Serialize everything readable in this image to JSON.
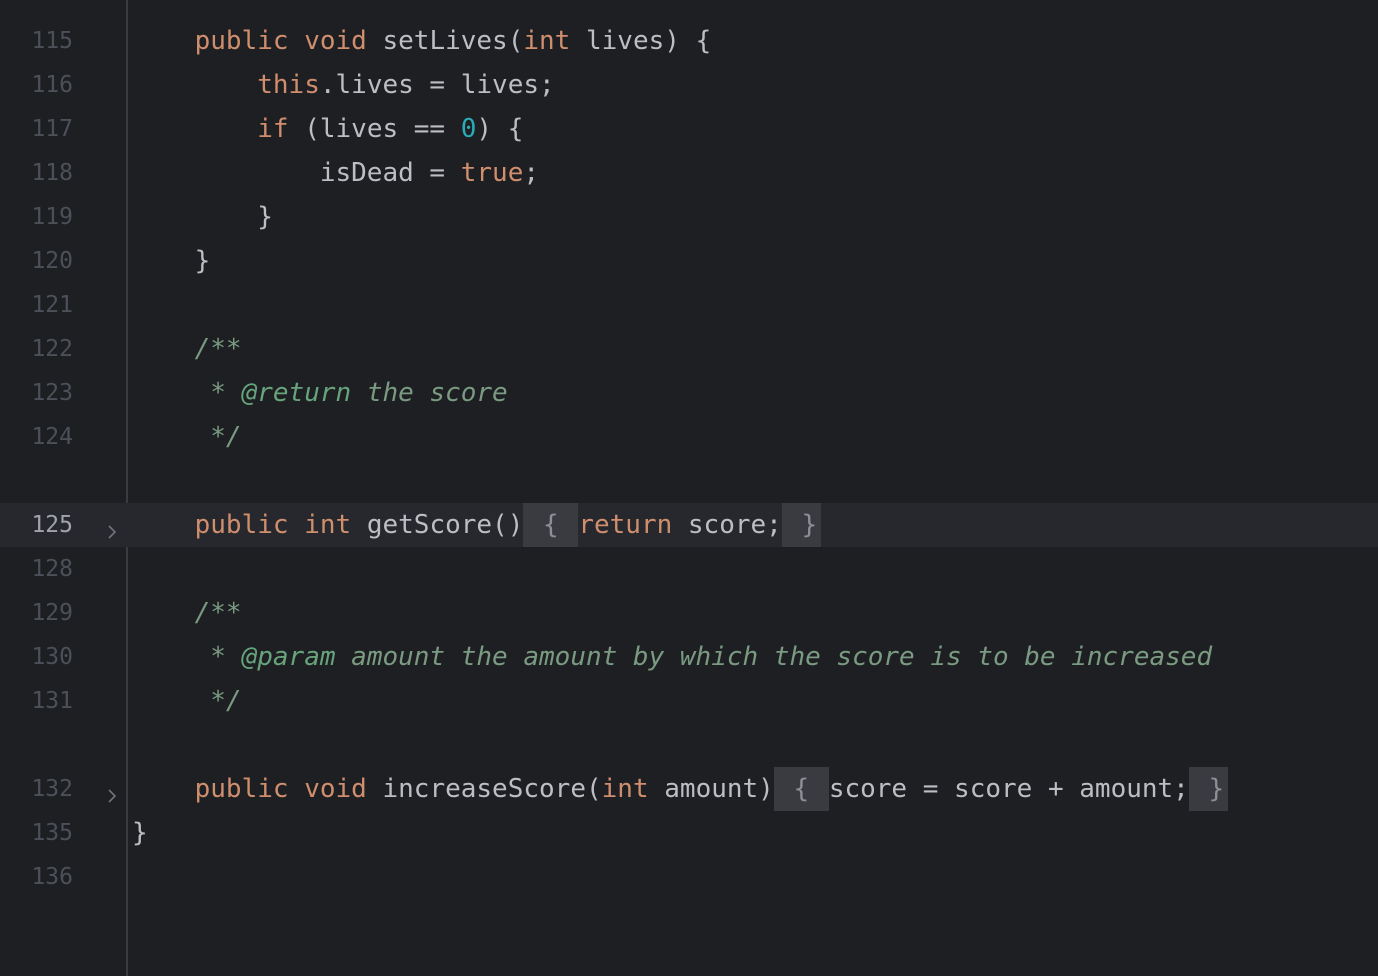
{
  "lines": [
    {
      "num": "115",
      "ind": "    ",
      "parts": [
        "public",
        " ",
        "void",
        " setLives(",
        "int",
        " lives) {"
      ]
    },
    {
      "num": "116",
      "ind": "        ",
      "parts": [
        "this",
        ".lives = lives;"
      ]
    },
    {
      "num": "117",
      "ind": "        ",
      "parts": [
        "if",
        " (lives == ",
        "0",
        ") {"
      ]
    },
    {
      "num": "118",
      "ind": "            ",
      "parts": [
        "isDead = ",
        "true",
        ";"
      ]
    },
    {
      "num": "119",
      "ind": "        ",
      "parts": [
        "}"
      ]
    },
    {
      "num": "120",
      "ind": "    ",
      "parts": [
        "}"
      ]
    },
    {
      "num": "121",
      "ind": "",
      "parts": []
    },
    {
      "num": "122",
      "ind": "    ",
      "parts": [
        "/**"
      ]
    },
    {
      "num": "123",
      "ind": "     ",
      "parts": [
        "* ",
        "@return",
        " the score"
      ]
    },
    {
      "num": "124",
      "ind": "     ",
      "parts": [
        "*/"
      ]
    },
    {
      "num": "125",
      "ind": "    ",
      "parts": [
        "public",
        " ",
        "int",
        " getScore()",
        " { ",
        "return",
        " score;",
        " }"
      ]
    },
    {
      "num": "128",
      "ind": "",
      "parts": []
    },
    {
      "num": "129",
      "ind": "    ",
      "parts": [
        "/**"
      ]
    },
    {
      "num": "130",
      "ind": "     ",
      "parts": [
        "* ",
        "@param",
        " amount the amount by which the score is to be increased"
      ]
    },
    {
      "num": "131",
      "ind": "     ",
      "parts": [
        "*/"
      ]
    },
    {
      "num": "132",
      "ind": "    ",
      "parts": [
        "public",
        " ",
        "void",
        " increaseScore(",
        "int",
        " amount)",
        " { ",
        "score = score + amount;",
        " }"
      ]
    },
    {
      "num": "135",
      "ind": "",
      "parts": [
        "}"
      ]
    },
    {
      "num": "136",
      "ind": "",
      "parts": []
    }
  ],
  "colors": {
    "background": "#1e1f22",
    "keyword": "#cf8e6d",
    "number": "#2aacb8",
    "comment": "#7a9a82",
    "doc_tag": "#67a37c",
    "text": "#bcbec4",
    "line_number": "#4b5059"
  }
}
